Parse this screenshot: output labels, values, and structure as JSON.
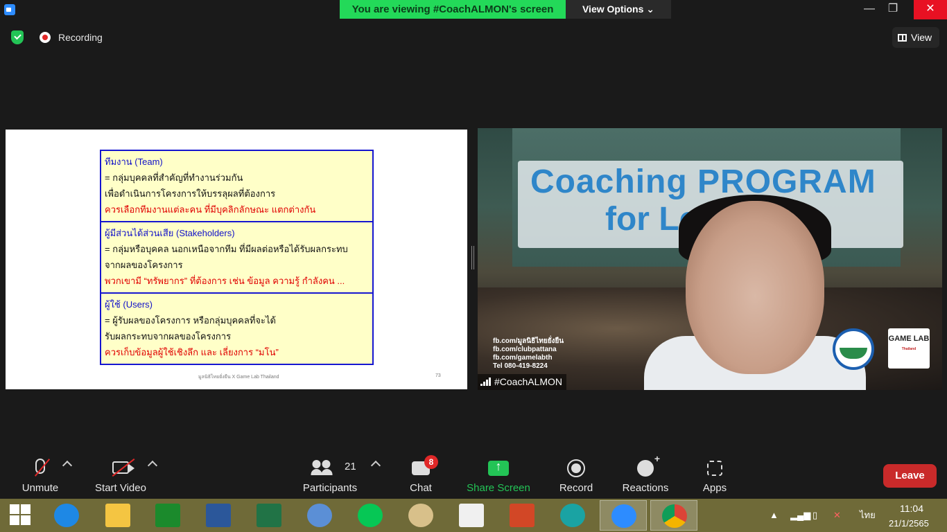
{
  "window": {
    "banner_text": "You are viewing #CoachALMON's screen",
    "view_options_label": "View Options ⌄",
    "minimize": "—",
    "maximize": "❐",
    "close": "✕"
  },
  "meeting_bar": {
    "recording_label": "Recording",
    "view_label": "View"
  },
  "slide": {
    "sections": [
      {
        "heading": "ทีมงาน (Team)",
        "lines": [
          "= กลุ่มบุคคลที่สำคัญที่ทำงานร่วมกัน",
          "เพื่อดำเนินการโครงการให้บรรลุผลที่ต้องการ"
        ],
        "highlight": "ควรเลือกทีมงานแต่ละคน ที่มีบุคลิกลักษณะ แตกต่างกัน"
      },
      {
        "heading": "ผู้มีส่วนได้ส่วนเสีย (Stakeholders)",
        "lines": [
          "= กลุ่มหรือบุคคล นอกเหนือจากทีม ที่มีผลต่อหรือได้รับผลกระทบ",
          "จากผลของโครงการ"
        ],
        "highlight": "พวกเขามี “ทรัพยากร” ที่ต้องการ เช่น ข้อมูล ความรู้ กำลังคน ..."
      },
      {
        "heading": "ผู้ใช้ (Users)",
        "lines": [
          "= ผู้รับผลของโครงการ หรือกลุ่มบุคคลที่จะได้",
          "รับผลกระทบจากผลของโครงการ"
        ],
        "highlight": "ควรเก็บข้อมูลผู้ใช้เชิงลึก และ เลี่ยงการ “มโน”"
      }
    ],
    "footer": "มูลนิธิไทยยั่งยืน X Game Lab Thailand",
    "page_number": "73"
  },
  "video": {
    "title_line1": "Coaching PROGRAM",
    "title_line2": "for Le    er",
    "contact_lines": [
      "fb.com/มูลนิธิไทยยั่งยืน",
      "fb.com/clubpattana",
      "fb.com/gamelabth",
      "Tel 080-419-8224"
    ],
    "logo_text": "GAME LAB",
    "logo_sub": "Thailand",
    "participant_name": "#CoachALMON"
  },
  "toolbar": {
    "unmute": "Unmute",
    "start_video": "Start Video",
    "participants": "Participants",
    "participant_count": "21",
    "chat": "Chat",
    "chat_badge": "8",
    "share_screen": "Share Screen",
    "record": "Record",
    "reactions": "Reactions",
    "apps": "Apps",
    "leave": "Leave"
  },
  "taskbar": {
    "apps": [
      "Internet Explorer",
      "File Explorer",
      "Store",
      "Word",
      "Excel",
      "Calculator",
      "LINE",
      "Paint",
      "LISREL",
      "PowerPoint",
      "Edge",
      "Zoom",
      "Chrome"
    ],
    "language": "ไทย",
    "time": "11:04",
    "date": "21/1/2565"
  },
  "colors": {
    "share_green": "#23c456",
    "leave_red": "#c92a2a",
    "banner_green": "#23d959",
    "slide_blue": "#1515d0",
    "slide_red": "#e00000",
    "slide_yellow": "#ffffc8"
  }
}
